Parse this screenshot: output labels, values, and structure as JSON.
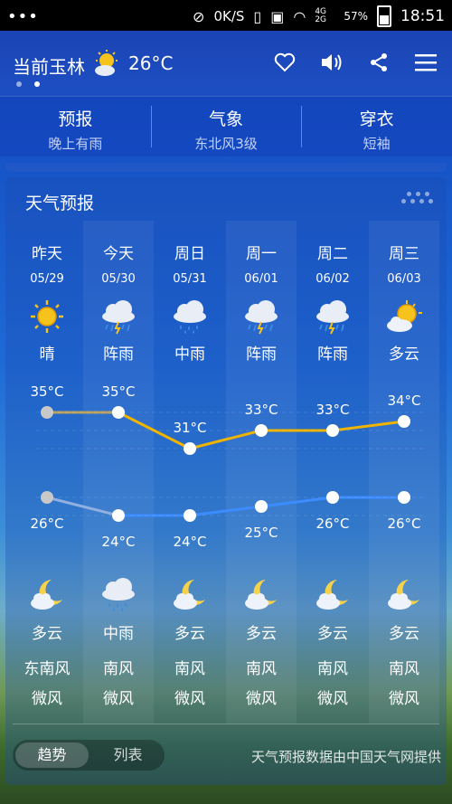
{
  "status_bar": {
    "dots": "•••",
    "speed": "0K/S",
    "signal_label": "4G 2G",
    "battery": "57%",
    "time": "18:51"
  },
  "header": {
    "city": "当前玉林",
    "temp": "26°C",
    "icons": [
      "heart-icon",
      "speaker-icon",
      "share-icon",
      "menu-icon"
    ]
  },
  "tabs": [
    {
      "title": "预报",
      "sub": "晚上有雨"
    },
    {
      "title": "气象",
      "sub": "东北风3级"
    },
    {
      "title": "穿衣",
      "sub": "短袖"
    }
  ],
  "forecast": {
    "title": "天气预报",
    "days": [
      {
        "name": "昨天",
        "date": "05/29",
        "day_icon": "sunny-icon",
        "day_cond": "晴",
        "high": "35°C",
        "low": "26°C",
        "night_icon": "moon-cloud-icon",
        "night_cond": "多云",
        "wind_dir": "东南风",
        "wind_level": "微风"
      },
      {
        "name": "今天",
        "date": "05/30",
        "day_icon": "thunder-rain-icon",
        "day_cond": "阵雨",
        "high": "35°C",
        "low": "24°C",
        "night_icon": "rain-cloud-icon",
        "night_cond": "中雨",
        "wind_dir": "南风",
        "wind_level": "微风"
      },
      {
        "name": "周日",
        "date": "05/31",
        "day_icon": "rain-cloud-icon",
        "day_cond": "中雨",
        "high": "31°C",
        "low": "24°C",
        "night_icon": "moon-cloud-icon",
        "night_cond": "多云",
        "wind_dir": "南风",
        "wind_level": "微风"
      },
      {
        "name": "周一",
        "date": "06/01",
        "day_icon": "thunder-rain-icon",
        "day_cond": "阵雨",
        "high": "33°C",
        "low": "25°C",
        "night_icon": "moon-cloud-icon",
        "night_cond": "多云",
        "wind_dir": "南风",
        "wind_level": "微风"
      },
      {
        "name": "周二",
        "date": "06/02",
        "day_icon": "thunder-rain-icon",
        "day_cond": "阵雨",
        "high": "33°C",
        "low": "26°C",
        "night_icon": "moon-cloud-icon",
        "night_cond": "多云",
        "wind_dir": "南风",
        "wind_level": "微风"
      },
      {
        "name": "周三",
        "date": "06/03",
        "day_icon": "partly-cloudy-icon",
        "day_cond": "多云",
        "high": "34°C",
        "low": "26°C",
        "night_icon": "moon-cloud-icon",
        "night_cond": "多云",
        "wind_dir": "南风",
        "wind_level": "微风"
      }
    ]
  },
  "chart_data": {
    "type": "line",
    "categories": [
      "昨天",
      "今天",
      "周日",
      "周一",
      "周二",
      "周三"
    ],
    "series": [
      {
        "values": [
          35,
          35,
          31,
          33,
          33,
          34
        ],
        "color": "#f0b400"
      },
      {
        "values": [
          26,
          24,
          24,
          25,
          26,
          26
        ],
        "color": "#3c8cff"
      }
    ]
  },
  "bottom": {
    "toggle": [
      "趋势",
      "列表"
    ],
    "active": "趋势",
    "source": "天气预报数据由中国天气网提供"
  },
  "colors": {
    "high_line": "#f0b400",
    "low_line": "#3c8cff",
    "header_bg": "#1b44b5"
  }
}
